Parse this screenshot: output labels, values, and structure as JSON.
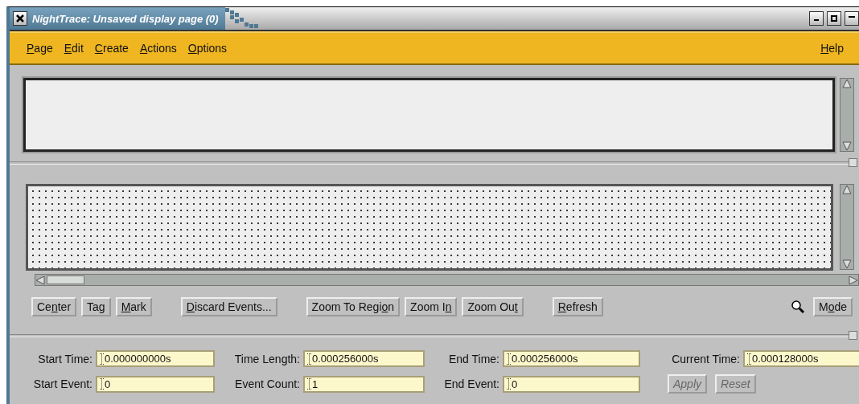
{
  "window": {
    "title": "NightTrace: Unsaved display page (0)"
  },
  "menu": [
    {
      "label": "Page"
    },
    {
      "label": "Edit"
    },
    {
      "label": "Create"
    },
    {
      "label": "Actions"
    },
    {
      "label": "Options"
    }
  ],
  "help_menu": {
    "label": "Help"
  },
  "toolbar": [
    {
      "label": "Center"
    },
    {
      "label": "Tag"
    },
    {
      "label": "Mark"
    },
    {
      "label": "Discard Events..."
    },
    {
      "label": "Zoom To Region"
    },
    {
      "label": "Zoom In"
    },
    {
      "label": "Zoom Out"
    },
    {
      "label": "Refresh"
    }
  ],
  "mode_button": {
    "label": "Mode"
  },
  "fields": [
    {
      "label": "Start Time:",
      "value": "0.000000000s"
    },
    {
      "label": "Time Length:",
      "value": "0.000256000s"
    },
    {
      "label": "End Time:",
      "value": "0.000256000s"
    },
    {
      "label": "Current Time:",
      "value": "0.000128000s"
    },
    {
      "label": "Start Event:",
      "value": "0"
    },
    {
      "label": "Event Count:",
      "value": "1"
    },
    {
      "label": "End Event:",
      "value": "0"
    }
  ],
  "actions": [
    {
      "label": "Apply",
      "disabled": true
    },
    {
      "label": "Reset",
      "disabled": true
    }
  ]
}
